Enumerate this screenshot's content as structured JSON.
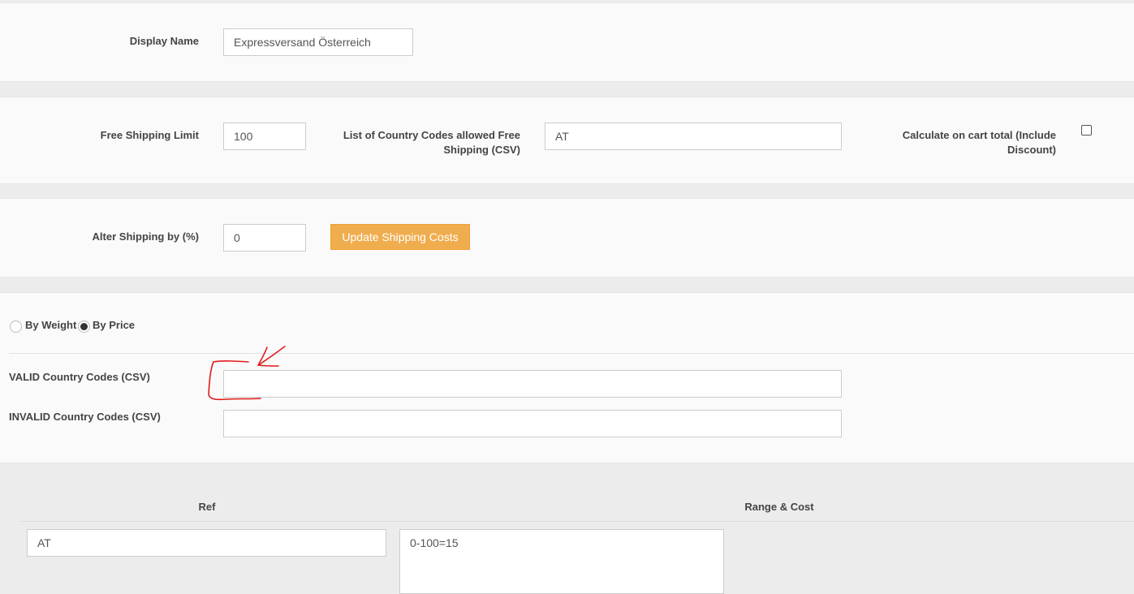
{
  "display_name": {
    "label": "Display Name",
    "value": "Expressversand Österreich"
  },
  "free_shipping": {
    "limit_label": "Free Shipping Limit",
    "limit_value": "100",
    "countries_label_line1": "List of Country Codes allowed Free",
    "countries_label_line2": "Shipping (CSV)",
    "countries_value": "AT",
    "cart_total_label_line1": "Calculate on cart total (Include",
    "cart_total_label_line2": "Discount)",
    "cart_total_checked": false
  },
  "alter_shipping": {
    "label": "Alter Shipping by (%)",
    "value": "0",
    "update_button": "Update Shipping Costs"
  },
  "mode": {
    "by_weight_label": "By Weight",
    "by_price_label": "By Price",
    "selected": "By Price"
  },
  "country_codes": {
    "valid_label": "VALID Country Codes (CSV)",
    "valid_value": "",
    "invalid_label": "INVALID Country Codes (CSV)",
    "invalid_value": ""
  },
  "rates_table": {
    "headers": {
      "ref": "Ref",
      "range_cost": "Range & Cost"
    },
    "rows": [
      {
        "ref": "AT",
        "range_cost": "0-100=15"
      }
    ]
  },
  "colors": {
    "button_accent": "#f0ad4e",
    "annotation": "#e01b1b"
  }
}
